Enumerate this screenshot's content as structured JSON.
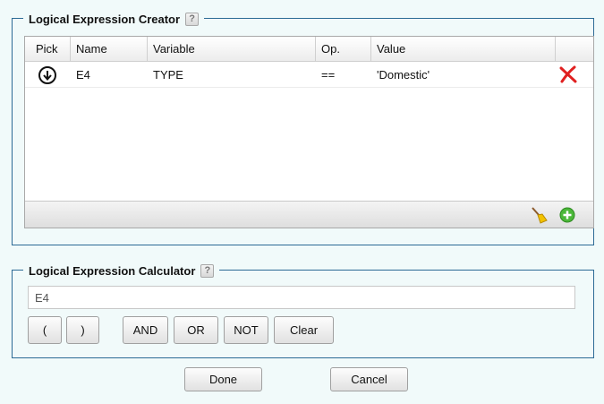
{
  "creator": {
    "legend": "Logical Expression Creator",
    "help": "?",
    "columns": [
      "Pick",
      "Name",
      "Variable",
      "Op.",
      "Value"
    ],
    "rows": [
      {
        "name": "E4",
        "variable": "TYPE",
        "op": "==",
        "value": "'Domestic'"
      }
    ],
    "icons": {
      "pick": "arrow-down-circle-icon",
      "delete": "red-x-icon",
      "clear": "broom-icon",
      "add": "green-plus-icon"
    }
  },
  "calculator": {
    "legend": "Logical Expression Calculator",
    "help": "?",
    "expression": "E4",
    "buttons": {
      "open_paren": "(",
      "close_paren": ")",
      "and": "AND",
      "or": "OR",
      "not": "NOT",
      "clear": "Clear"
    }
  },
  "footer": {
    "done": "Done",
    "cancel": "Cancel"
  },
  "colors": {
    "border": "#2c6a95",
    "background": "#f1fafa",
    "delete": "#e02020",
    "add": "#4cb83a"
  }
}
